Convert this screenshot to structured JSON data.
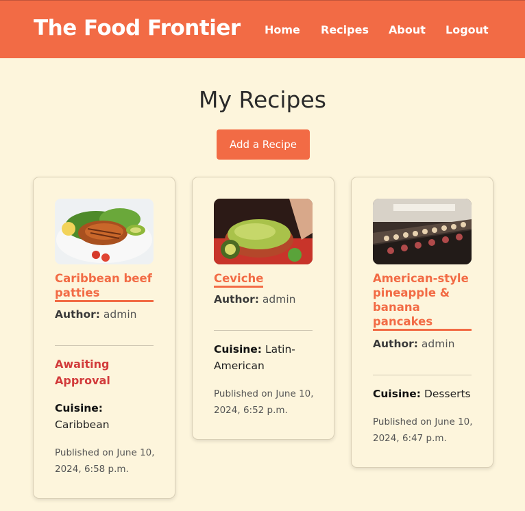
{
  "nav": {
    "brand": "The Food Frontier",
    "links": [
      "Home",
      "Recipes",
      "About",
      "Logout"
    ]
  },
  "main": {
    "title": "My Recipes",
    "add_button": "Add a Recipe"
  },
  "recipes": [
    {
      "title": "Caribbean beef patties",
      "author_label": "Author:",
      "author": "admin",
      "status": "Awaiting Approval",
      "cuisine_label": "Cuisine:",
      "cuisine": "Caribbean",
      "published": "Published on June 10, 2024, 6:58 p.m.",
      "image_icon": "grilled-salmon-salad-photo"
    },
    {
      "title": "Ceviche",
      "author_label": "Author:",
      "author": "admin",
      "cuisine_label": "Cuisine:",
      "cuisine": "Latin-American",
      "published": "Published on June 10, 2024, 6:52 p.m.",
      "image_icon": "guacamole-bowl-photo"
    },
    {
      "title": "American-style pineapple & banana pancakes",
      "author_label": "Author:",
      "author": "admin",
      "cuisine_label": "Cuisine:",
      "cuisine": "Desserts",
      "published": "Published on June 10, 2024, 6:47 p.m.",
      "image_icon": "pastry-display-photo"
    }
  ],
  "colors": {
    "accent": "#f26b45",
    "background": "#fdf5dc",
    "status": "#d23b3b"
  }
}
